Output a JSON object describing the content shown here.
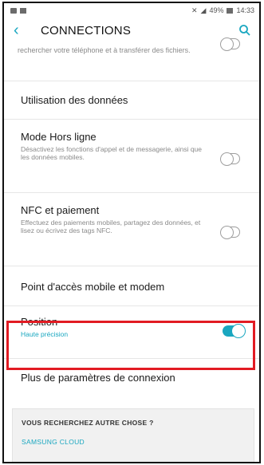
{
  "status_bar": {
    "battery_signal": "49%",
    "time": "14:33"
  },
  "app_bar": {
    "title": "CONNECTIONS"
  },
  "partial_item": {
    "description": "rechercher votre téléphone et à transférer des fichiers."
  },
  "items": [
    {
      "title": "Utilisation des données"
    },
    {
      "title": "Mode Hors ligne",
      "description": "Désactivez les fonctions d'appel et de messagerie, ainsi que les données mobiles.",
      "toggle": "off"
    },
    {
      "title": "NFC et paiement",
      "description": "Effectuez des paiements mobiles, partagez des données, et lisez ou écrivez des tags NFC.",
      "toggle": "off"
    },
    {
      "title": "Point d'accès mobile et modem"
    },
    {
      "title": "Position",
      "description": "Haute précision",
      "toggle": "on"
    },
    {
      "title": "Plus de paramètres de connexion"
    }
  ],
  "footer": {
    "heading": "VOUS RECHERCHEZ AUTRE CHOSE ?",
    "link": "SAMSUNG CLOUD"
  },
  "colors": {
    "accent": "#1aa7c0",
    "highlight_border": "#e21b23"
  }
}
